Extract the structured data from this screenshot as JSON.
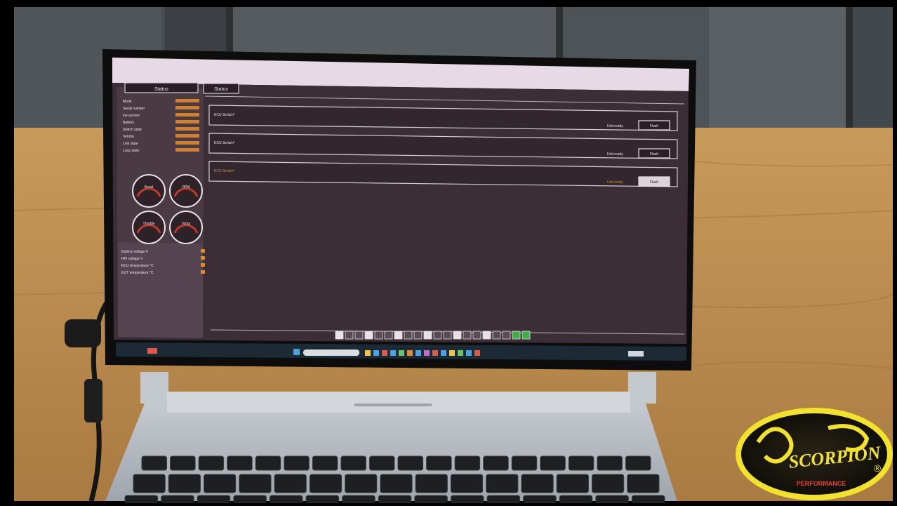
{
  "scene": {
    "colors": {
      "wall": "#4b4f53",
      "table": "#b88a4e",
      "laptop_body": "#b7bcc3",
      "bezel": "#111111",
      "app_bg": "#3b2e36",
      "app_panel": "#4a3a44",
      "app_accent": "#e08a2c",
      "taskbar": "#1c2a36"
    }
  },
  "app": {
    "left_panel": {
      "button_label": "Status",
      "rows": [
        "Mode",
        "Serial number",
        "Fw version",
        "Battery",
        "Switch state",
        "Vehicle",
        "Link state",
        "Loop state"
      ],
      "gauges": [
        "Boost",
        "RPM",
        "Throttle",
        "Temp"
      ],
      "bottom_rows": [
        "Battery voltage V",
        "RPI voltage V",
        "ECU temperature °C",
        "EGT temperature °C"
      ]
    },
    "main": {
      "tab_label": "Status",
      "sections": [
        {
          "title": "ECU Serial #",
          "status": "Unit ready",
          "button": "Flash"
        },
        {
          "title": "ECU Serial #",
          "status": "Unit ready",
          "button": "Flash"
        },
        {
          "title": "ECU Serial #",
          "status": "Unit ready",
          "button": "Flash"
        }
      ]
    }
  },
  "logo": {
    "name": "SCORPION",
    "subtitle": "PERFORMANCE",
    "mark": "®"
  }
}
